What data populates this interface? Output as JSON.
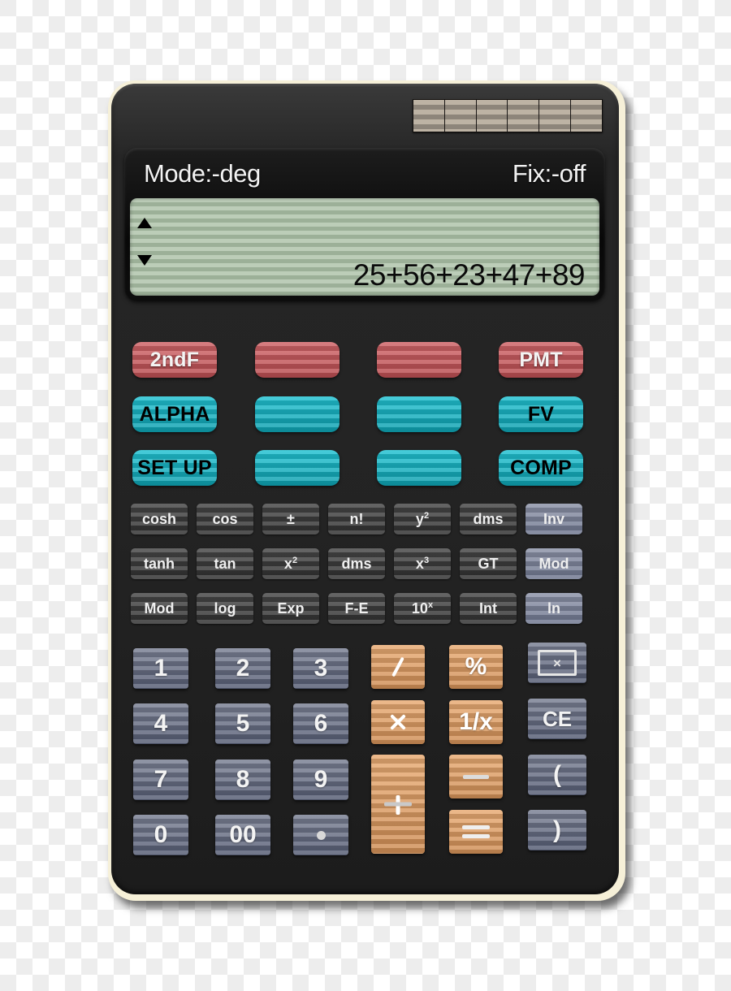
{
  "display": {
    "mode_label": "Mode:-deg",
    "fix_label": "Fix:-off",
    "expression": "25+56+23+47+89",
    "scroll_up_icon": "triangle-up-icon",
    "scroll_down_icon": "triangle-down-icon"
  },
  "solar": {
    "cell_count": 6
  },
  "colors": {
    "shell": "#f6f0d8",
    "body": "#262626",
    "lcd": "#a9bda5",
    "red_key": "#c4565a",
    "teal_key": "#1bb8c8",
    "slate_key": "#646b82",
    "orange_key": "#de9b65",
    "light_fn_key": "#7e859b"
  },
  "function_keys": {
    "red_row": [
      {
        "label": "2ndF",
        "blank": false
      },
      {
        "label": "",
        "blank": true
      },
      {
        "label": "",
        "blank": true
      },
      {
        "label": "PMT",
        "blank": false
      }
    ],
    "teal_row_1": [
      {
        "label": "ALPHA",
        "blank": false
      },
      {
        "label": "",
        "blank": true
      },
      {
        "label": "",
        "blank": true
      },
      {
        "label": "FV",
        "blank": false
      }
    ],
    "teal_row_2": [
      {
        "label": "SET UP",
        "blank": false
      },
      {
        "label": "",
        "blank": true
      },
      {
        "label": "",
        "blank": true
      },
      {
        "label": "COMP",
        "blank": false
      }
    ]
  },
  "small_keys": {
    "row_1": [
      {
        "label": "cosh"
      },
      {
        "label": "cos"
      },
      {
        "label": "±"
      },
      {
        "label": "n!"
      },
      {
        "label": "y",
        "sup": "2"
      },
      {
        "label": "dms"
      },
      {
        "label": "Inv",
        "light": true
      }
    ],
    "row_2": [
      {
        "label": "tanh"
      },
      {
        "label": "tan"
      },
      {
        "label": "x",
        "sup": "2"
      },
      {
        "label": "dms"
      },
      {
        "label": "x",
        "sup": "3"
      },
      {
        "label": "GT"
      },
      {
        "label": "Mod",
        "light": true
      }
    ],
    "row_3": [
      {
        "label": "Mod"
      },
      {
        "label": "log"
      },
      {
        "label": "Exp"
      },
      {
        "label": "F-E"
      },
      {
        "label": "10",
        "sup": "x"
      },
      {
        "label": "Int"
      },
      {
        "label": "ln",
        "light": true
      }
    ]
  },
  "keypad": {
    "digits": [
      {
        "label": "1"
      },
      {
        "label": "2"
      },
      {
        "label": "3"
      },
      {
        "label": "4"
      },
      {
        "label": "5"
      },
      {
        "label": "6"
      },
      {
        "label": "7"
      },
      {
        "label": "8"
      },
      {
        "label": "9"
      },
      {
        "label": "0"
      },
      {
        "label": "00"
      }
    ],
    "decimal_point": {
      "icon": "dot-icon",
      "label": "."
    },
    "operators": {
      "divide": {
        "icon": "divide-slash-icon",
        "label": "/"
      },
      "percent": {
        "label": "%"
      },
      "multiply": {
        "icon": "multiply-icon",
        "label": "×"
      },
      "reciprocal": {
        "label": "1/x"
      },
      "minus": {
        "icon": "minus-icon",
        "label": "−"
      },
      "plus": {
        "icon": "plus-icon",
        "label": "+"
      },
      "equals": {
        "icon": "equals-icon",
        "label": "="
      }
    },
    "right_column": {
      "delete": {
        "icon": "boxed-x-icon",
        "label": "×"
      },
      "clear_entry": {
        "label": "CE"
      },
      "paren_open": {
        "label": "("
      },
      "paren_close": {
        "label": ")"
      }
    }
  }
}
